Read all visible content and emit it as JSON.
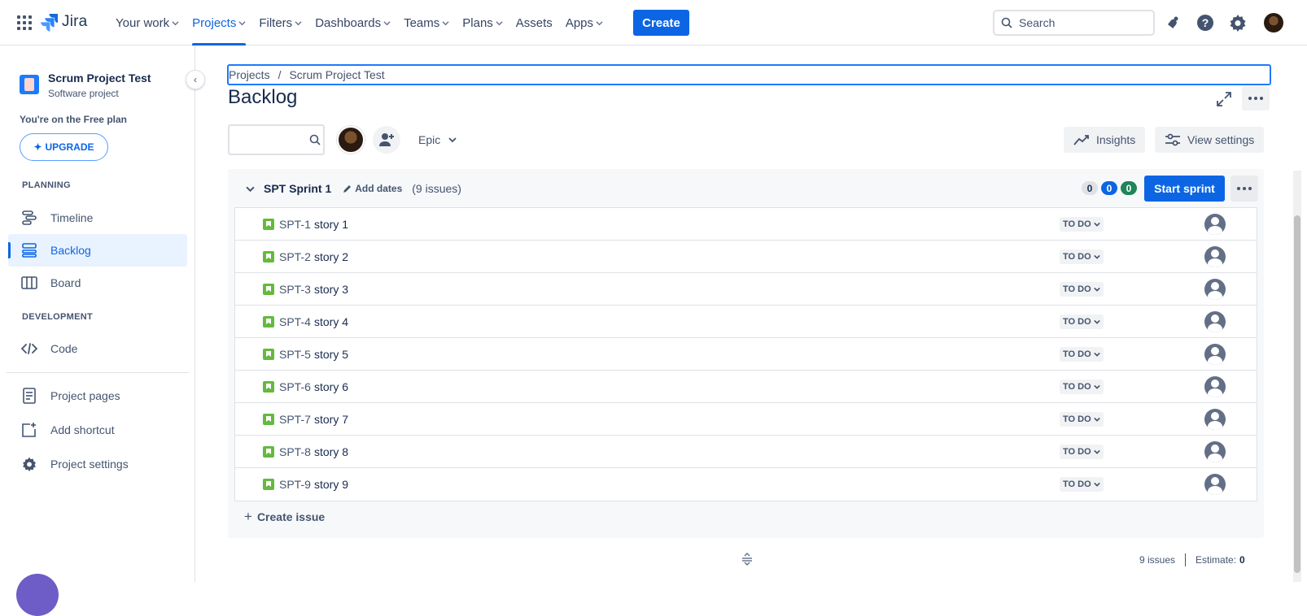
{
  "topnav": {
    "logo": "Jira",
    "items": [
      {
        "label": "Your work",
        "chevron": true
      },
      {
        "label": "Projects",
        "chevron": true,
        "active": true
      },
      {
        "label": "Filters",
        "chevron": true
      },
      {
        "label": "Dashboards",
        "chevron": true
      },
      {
        "label": "Teams",
        "chevron": true
      },
      {
        "label": "Plans",
        "chevron": true
      },
      {
        "label": "Assets",
        "chevron": false
      },
      {
        "label": "Apps",
        "chevron": true
      }
    ],
    "create_label": "Create",
    "search_placeholder": "Search",
    "accent_color": "#0c66e4"
  },
  "sidebar": {
    "project_name": "Scrum Project Test",
    "project_type": "Software project",
    "plan_text": "You're on the Free plan",
    "upgrade_label": "UPGRADE",
    "planning_label": "PLANNING",
    "development_label": "DEVELOPMENT",
    "items": [
      {
        "label": "Timeline",
        "icon": "timeline-icon"
      },
      {
        "label": "Backlog",
        "icon": "backlog-icon",
        "active": true
      },
      {
        "label": "Board",
        "icon": "board-icon"
      },
      {
        "label": "Code",
        "icon": "code-icon"
      },
      {
        "label": "Project pages",
        "icon": "pages-icon"
      },
      {
        "label": "Add shortcut",
        "icon": "add-shortcut-icon"
      },
      {
        "label": "Project settings",
        "icon": "gear-icon"
      }
    ]
  },
  "breadcrumb": {
    "root": "Projects",
    "separator": "/",
    "project": "Scrum Project Test"
  },
  "page": {
    "title": "Backlog"
  },
  "toolbar": {
    "epic_label": "Epic",
    "insights_label": "Insights",
    "view_settings_label": "View settings"
  },
  "sprint": {
    "name": "SPT Sprint 1",
    "add_dates_label": "Add dates",
    "issue_count_label": "(9 issues)",
    "badges": [
      {
        "value": "0",
        "bg": "#dfe1e6",
        "fg": "#172b4d"
      },
      {
        "value": "0",
        "bg": "#0c66e4",
        "fg": "#ffffff"
      },
      {
        "value": "0",
        "bg": "#1f845a",
        "fg": "#ffffff"
      }
    ],
    "start_label": "Start sprint",
    "issues": [
      {
        "key": "SPT-1",
        "summary": "story 1",
        "status": "TO DO"
      },
      {
        "key": "SPT-2",
        "summary": "story 2",
        "status": "TO DO"
      },
      {
        "key": "SPT-3",
        "summary": "story 3",
        "status": "TO DO"
      },
      {
        "key": "SPT-4",
        "summary": "story 4",
        "status": "TO DO"
      },
      {
        "key": "SPT-5",
        "summary": "story 5",
        "status": "TO DO"
      },
      {
        "key": "SPT-6",
        "summary": "story 6",
        "status": "TO DO"
      },
      {
        "key": "SPT-7",
        "summary": "story 7",
        "status": "TO DO"
      },
      {
        "key": "SPT-8",
        "summary": "story 8",
        "status": "TO DO"
      },
      {
        "key": "SPT-9",
        "summary": "story 9",
        "status": "TO DO"
      }
    ],
    "create_issue_label": "Create issue"
  },
  "footer": {
    "issues_label": "9 issues",
    "estimate_label": "Estimate:",
    "estimate_value": "0"
  }
}
